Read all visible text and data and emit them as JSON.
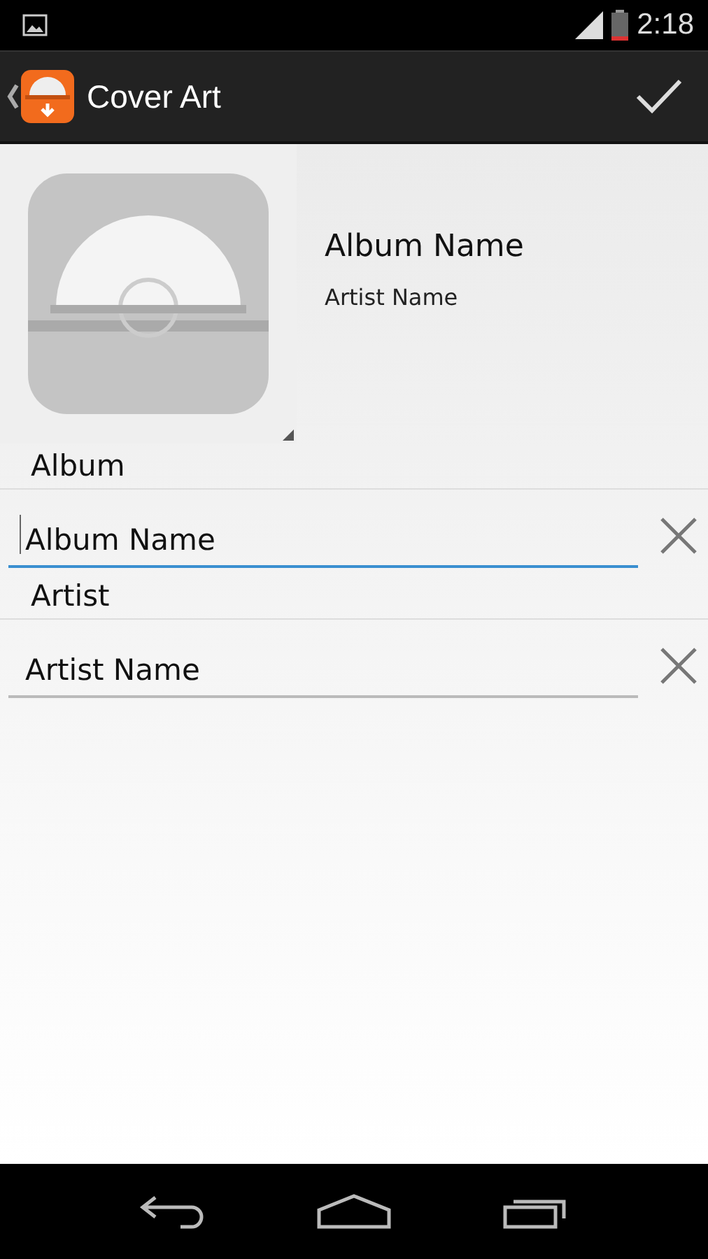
{
  "status_bar": {
    "time": "2:18"
  },
  "action_bar": {
    "title": "Cover Art"
  },
  "header": {
    "album": "Album Name",
    "artist": "Artist Name"
  },
  "fields": [
    {
      "label": "Album",
      "value": "Album Name",
      "focused": true
    },
    {
      "label": "Artist",
      "value": "Artist Name",
      "focused": false
    }
  ]
}
